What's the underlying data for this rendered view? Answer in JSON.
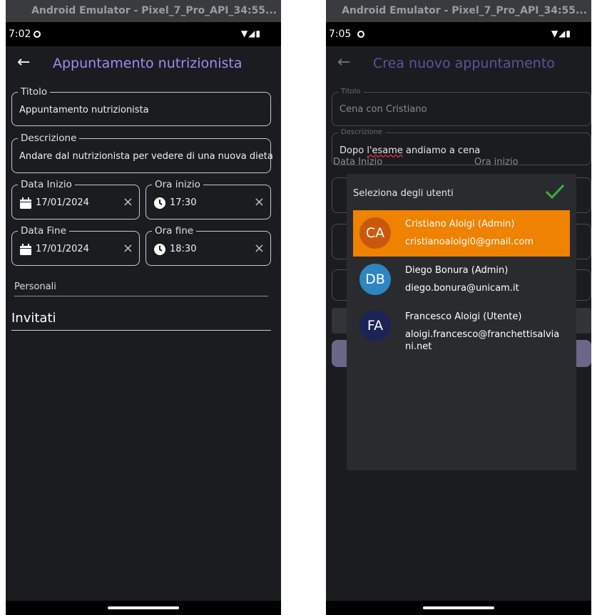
{
  "left": {
    "window_title": "Android Emulator - Pixel_7_Pro_API_34:55...",
    "time": "7:02",
    "appbar_title": "Appuntamento nutrizionista",
    "fields": {
      "titolo_label": "Titolo",
      "titolo_value": "Appuntamento nutrizionista",
      "descrizione_label": "Descrizione",
      "descrizione_value": "Andare dal nutrizionista per vedere di una nuova dieta",
      "data_inizio_label": "Data Inizio",
      "data_inizio_value": "17/01/2024",
      "ora_inizio_label": "Ora inizio",
      "ora_inizio_value": "17:30",
      "data_fine_label": "Data Fine",
      "data_fine_value": "17/01/2024",
      "ora_fine_label": "Ora fine",
      "ora_fine_value": "18:30"
    },
    "personali_label": "Personali",
    "invitati_label": "Invitati",
    "clear_icon": "×"
  },
  "right": {
    "window_title": "Android Emulator - Pixel_7_Pro_API_34:55...",
    "time": "7:05",
    "appbar_title": "Crea nuovo appuntamento",
    "titolo_label": "Titolo",
    "titolo_value": "Cena con Cristiano",
    "descrizione_label": "Descrizione",
    "descrizione_value_a": "Dopo ",
    "descrizione_value_b": "l'esame",
    "descrizione_value_c": " andiamo a cena",
    "data_inizio_label": "Data Inizio",
    "ora_inizio_label": "Ora inizio",
    "dialog": {
      "title": "Seleziona degli utenti",
      "users": [
        {
          "initials": "CA",
          "name": "Cristiano Aloigi (Admin)",
          "email": "cristianoaloigi0@gmail.com",
          "color": "#c9580c",
          "selected": true
        },
        {
          "initials": "DB",
          "name": "Diego Bonura (Admin)",
          "email": "diego.bonura@unicam.it",
          "color": "#2e86c1",
          "selected": false
        },
        {
          "initials": "FA",
          "name": "Francesco Aloigi (Utente)",
          "email": "aloigi.francesco@franchettisalviani.net",
          "color": "#1c2456",
          "selected": false
        }
      ]
    }
  },
  "colors": {
    "accent": "#a18af2",
    "selected": "#ef8200",
    "check": "#3cb043"
  }
}
